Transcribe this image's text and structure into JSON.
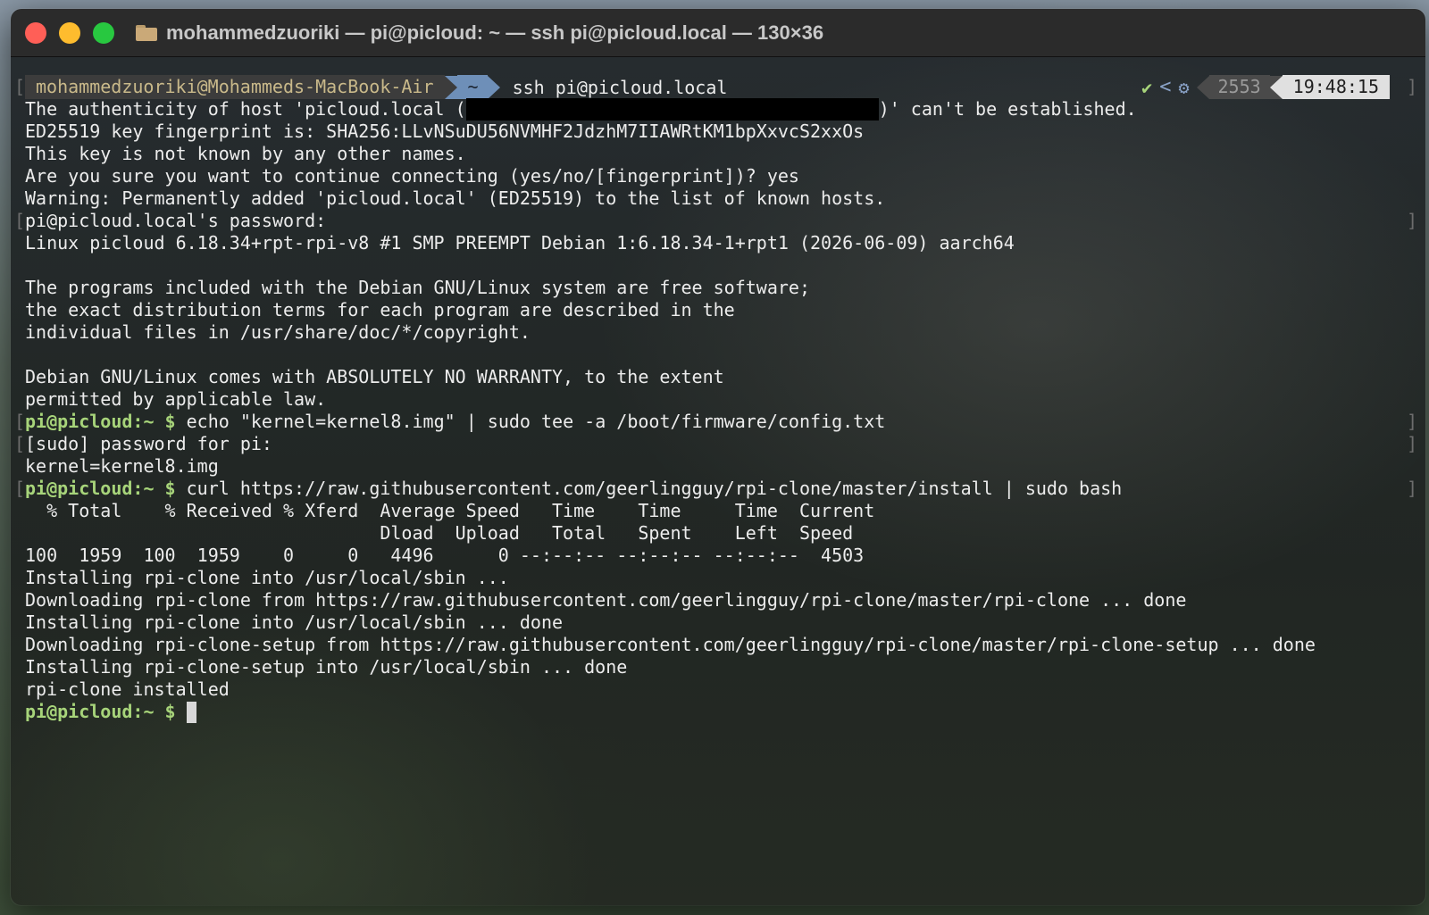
{
  "window": {
    "title": "mohammedzuoriki — pi@picloud: ~ — ssh pi@picloud.local — 130×36",
    "folder_icon": "folder-icon"
  },
  "prompt_bar": {
    "user_host": "mohammedzuoriki@Mohammeds-MacBook-Air",
    "directory": "~",
    "command": "ssh pi@picloud.local",
    "status_check": "✔",
    "status_lt": "<",
    "status_gear": "⚙",
    "history_count": "2553",
    "clock": "19:48:15"
  },
  "colors": {
    "prompt_green": "#a7d47a",
    "text": "#ececec",
    "powerline_blue": "#6e8fb8"
  },
  "terminal": {
    "host_prefix": "The authenticity of host 'picloud.local (",
    "host_suffix": ")' can't be established.",
    "lines": [
      "ED25519 key fingerprint is: SHA256:LLvNSuDU56NVMHF2JdzhM7IIAWRtKM1bpXxvcS2xxOs",
      "This key is not known by any other names.",
      "Are you sure you want to continue connecting (yes/no/[fingerprint])? yes",
      "Warning: Permanently added 'picloud.local' (ED25519) to the list of known hosts.",
      "pi@picloud.local's password:",
      "Linux picloud 6.18.34+rpt-rpi-v8 #1 SMP PREEMPT Debian 1:6.18.34-1+rpt1 (2026-06-09) aarch64",
      "",
      "The programs included with the Debian GNU/Linux system are free software;",
      "the exact distribution terms for each program are described in the",
      "individual files in /usr/share/doc/*/copyright.",
      "",
      "Debian GNU/Linux comes with ABSOLUTELY NO WARRANTY, to the extent",
      "permitted by applicable law."
    ],
    "remote_prompt_user": "pi@picloud",
    "remote_prompt_dir": ":~ ",
    "remote_prompt_dollar": "$",
    "cmd1": " echo \"kernel=kernel8.img\" | sudo tee -a /boot/firmware/config.txt",
    "sudo_prompt": "[sudo] password for pi:",
    "cmd1_output": "kernel=kernel8.img",
    "cmd2": " curl https://raw.githubusercontent.com/geerlingguy/rpi-clone/master/install | sudo bash",
    "curl_header1": "  % Total    % Received % Xferd  Average Speed   Time    Time     Time  Current",
    "curl_header2": "                                 Dload  Upload   Total   Spent    Left  Speed",
    "curl_progress": "100  1959  100  1959    0     0   4496      0 --:--:-- --:--:-- --:--:--  4503",
    "install_lines": [
      "Installing rpi-clone into /usr/local/sbin ...",
      "Downloading rpi-clone from https://raw.githubusercontent.com/geerlingguy/rpi-clone/master/rpi-clone ... done",
      "Installing rpi-clone into /usr/local/sbin ... done",
      "Downloading rpi-clone-setup from https://raw.githubusercontent.com/geerlingguy/rpi-clone/master/rpi-clone-setup ... done",
      "Installing rpi-clone-setup into /usr/local/sbin ... done",
      "rpi-clone installed"
    ],
    "bracket_left": "[",
    "bracket_right": "]"
  }
}
